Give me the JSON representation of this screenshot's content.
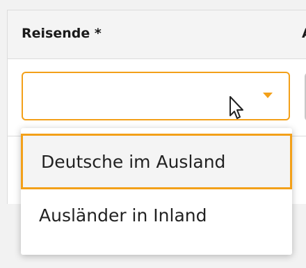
{
  "table": {
    "column_title": "Reisende *",
    "next_column_title": "A"
  },
  "select": {
    "value": "",
    "caret_icon": "chevron-down-icon",
    "accent_color": "#f3a019"
  },
  "dropdown": {
    "options": [
      {
        "label": "Deutsche im Ausland",
        "highlighted": true
      },
      {
        "label": "Ausländer in Inland",
        "highlighted": false
      }
    ]
  },
  "cursor": {
    "icon": "mouse-pointer-icon"
  }
}
